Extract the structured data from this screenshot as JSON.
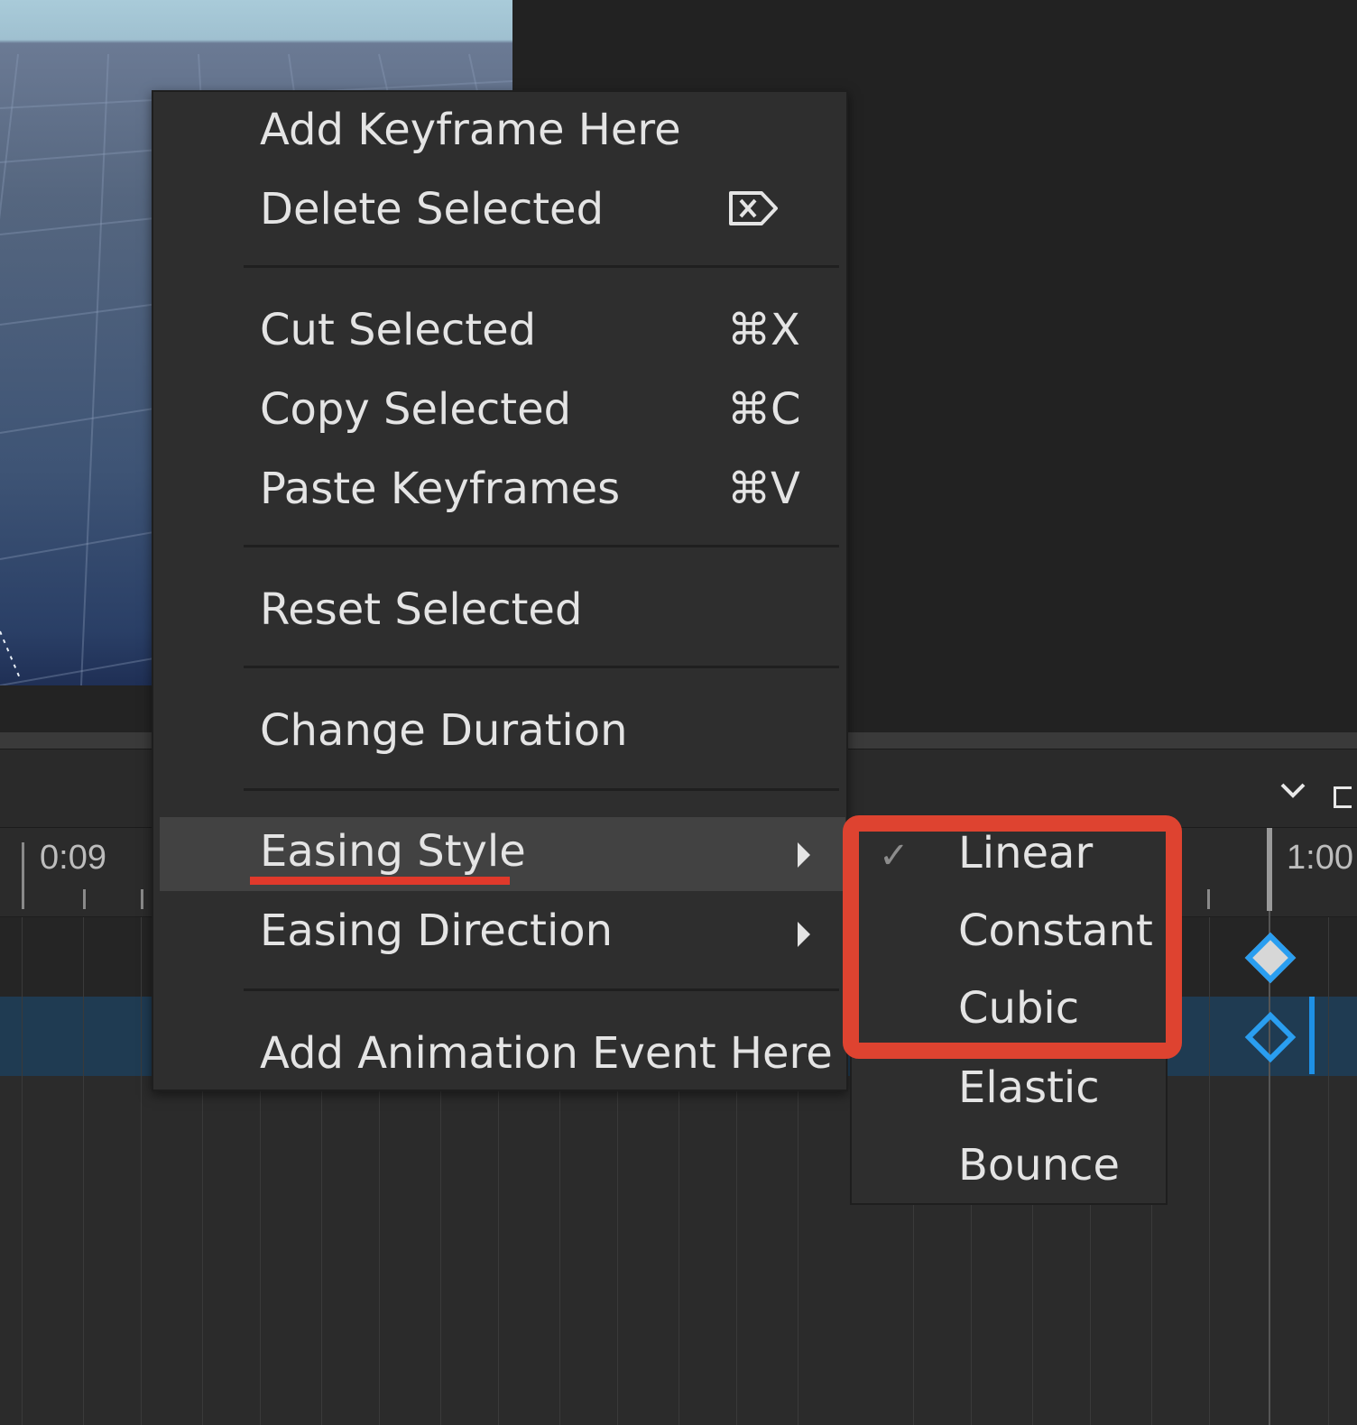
{
  "context_menu": {
    "items": [
      {
        "label": "Add Keyframe Here",
        "shortcut": ""
      },
      {
        "label": "Delete Selected",
        "shortcut": "⌦"
      },
      {
        "label": "Cut Selected",
        "shortcut": "⌘X"
      },
      {
        "label": "Copy Selected",
        "shortcut": "⌘C"
      },
      {
        "label": "Paste Keyframes",
        "shortcut": "⌘V"
      },
      {
        "label": "Reset Selected",
        "shortcut": ""
      },
      {
        "label": "Change Duration",
        "shortcut": ""
      },
      {
        "label": "Easing Style",
        "shortcut": "",
        "submenu": true,
        "highlighted": true
      },
      {
        "label": "Easing Direction",
        "shortcut": "",
        "submenu": true
      },
      {
        "label": "Add Animation Event Here",
        "shortcut": ""
      }
    ]
  },
  "easing_submenu": {
    "items": [
      {
        "label": "Linear",
        "checked": true
      },
      {
        "label": "Constant",
        "checked": false
      },
      {
        "label": "Cubic",
        "checked": false
      },
      {
        "label": "Elastic",
        "checked": false
      },
      {
        "label": "Bounce",
        "checked": false
      }
    ],
    "check_mark": "✓"
  },
  "timeline": {
    "start_label": "0:09",
    "end_label": "1:00"
  },
  "annotation": {
    "highlight_color": "#de4330"
  }
}
